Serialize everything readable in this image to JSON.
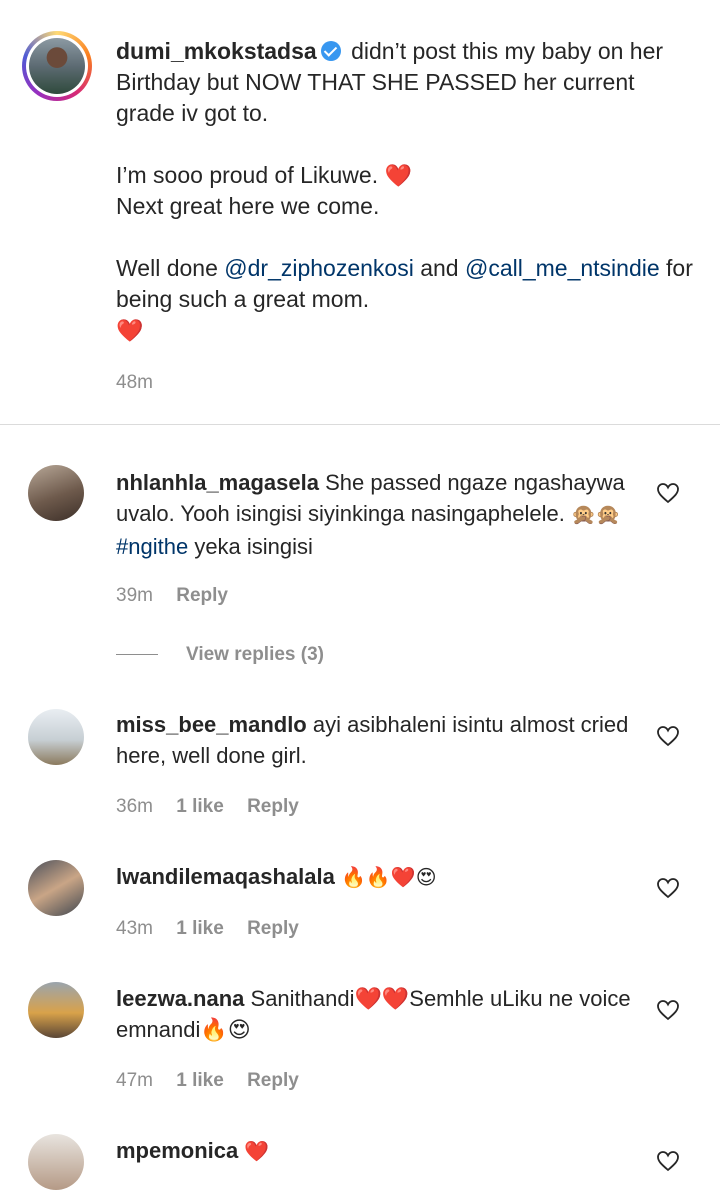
{
  "caption": {
    "username": "dumi_mkokstadsa",
    "verified_icon": "verified-badge-icon",
    "line1_text": "didn’t post this my baby on her Birthday but NOW THAT SHE PASSED her current grade iv got to.",
    "line2_text": "I’m sooo proud of Likuwe.",
    "line2_heart": "❤️",
    "line3_text": "Next great here we come.",
    "line4_prefix": "Well done",
    "mention1": "@dr_ziphozenkosi",
    "line4_mid": "and",
    "mention2": "@call_me_ntsindie",
    "line4_suffix": "for being such a great mom.",
    "line4_heart": "❤️",
    "time": "48m"
  },
  "comments": [
    {
      "username": "nhlanhla_magasela",
      "text_before": "She passed ngaze ngashaywa uvalo. Yooh isingisi siyinkinga nasingaphelele.",
      "emojis": "🙊🙊",
      "hashtag": "#ngithe",
      "text_after": "yeka isingisi",
      "time": "39m",
      "reply": "Reply",
      "view_replies": "View replies (3)"
    },
    {
      "username": "miss_bee_mandlo",
      "text": "ayi asibhaleni isintu almost cried here, well done girl.",
      "time": "36m",
      "likes": "1 like",
      "reply": "Reply"
    },
    {
      "username": "lwandilemaqashalala",
      "emojis": "🔥🔥❤️😍",
      "time": "43m",
      "likes": "1 like",
      "reply": "Reply"
    },
    {
      "username": "leezwa.nana",
      "text": "Sanithandi❤️❤️Semhle uLiku ne voice emnandi🔥😍",
      "time": "47m",
      "likes": "1 like",
      "reply": "Reply"
    },
    {
      "username": "mpemonica",
      "emojis": "❤️"
    }
  ],
  "colors": {
    "mention": "#003569",
    "meta": "#8e8e8e",
    "divider": "#dbdbdb",
    "verified": "#3897f0"
  }
}
